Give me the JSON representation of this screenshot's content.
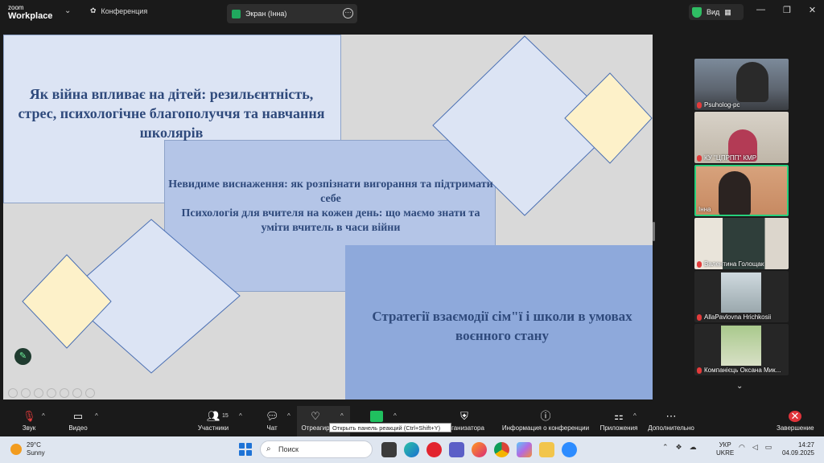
{
  "titlebar": {
    "logo_small": "zoom",
    "logo_big": "Workplace",
    "chevron": "⌄",
    "conference_label": "Конференция",
    "tab_label": "Экран (Інна)",
    "view_label": "Вид"
  },
  "slide": {
    "title1": "Як війна впливає на дітей: резильєнтність, стрес, психологічне благополуччя та навчання школярів",
    "title2": "Невидиме виснаження: як розпізнати вигорання та підтримати себе\nПсихологія для вчителя на кожен день: що маємо знати та уміти вчитель в часи війни",
    "title3": "Стратегії взаємодії сім\"ї і школи в умовах воєнного стану",
    "colors": {
      "panel_light": "#dce4f4",
      "panel_mid": "#b4c5e7",
      "panel_dark": "#8ea9db",
      "diamond_yellow": "#fdf1c9",
      "text": "#2f4a7c"
    }
  },
  "participants": [
    {
      "name": "Psuholog-pc"
    },
    {
      "name": "КУ \"ЦПРПП\" КМР"
    },
    {
      "name": "Інна"
    },
    {
      "name": "Валентина Голощак"
    },
    {
      "name": "AllaPavlovna Hrichkosii"
    },
    {
      "name": "Компанієць Оксана Мик..."
    }
  ],
  "toolbar": {
    "audio": "Звук",
    "video": "Видео",
    "participants": "Участники",
    "participants_count": "15",
    "chat": "Чат",
    "react": "Отреагир",
    "host_tools": "организатора",
    "meeting_info": "Информация о конференции",
    "apps": "Приложения",
    "more": "Дополнительно",
    "end": "Завершение",
    "tooltip": "Открыть панель реакций (Ctrl+Shift+Y)"
  },
  "taskbar": {
    "temp": "29°C",
    "weather": "Sunny",
    "search": "Поиск",
    "lang1": "УКР",
    "lang2": "UKRE",
    "time": "14:27",
    "date": "04.09.2025"
  }
}
